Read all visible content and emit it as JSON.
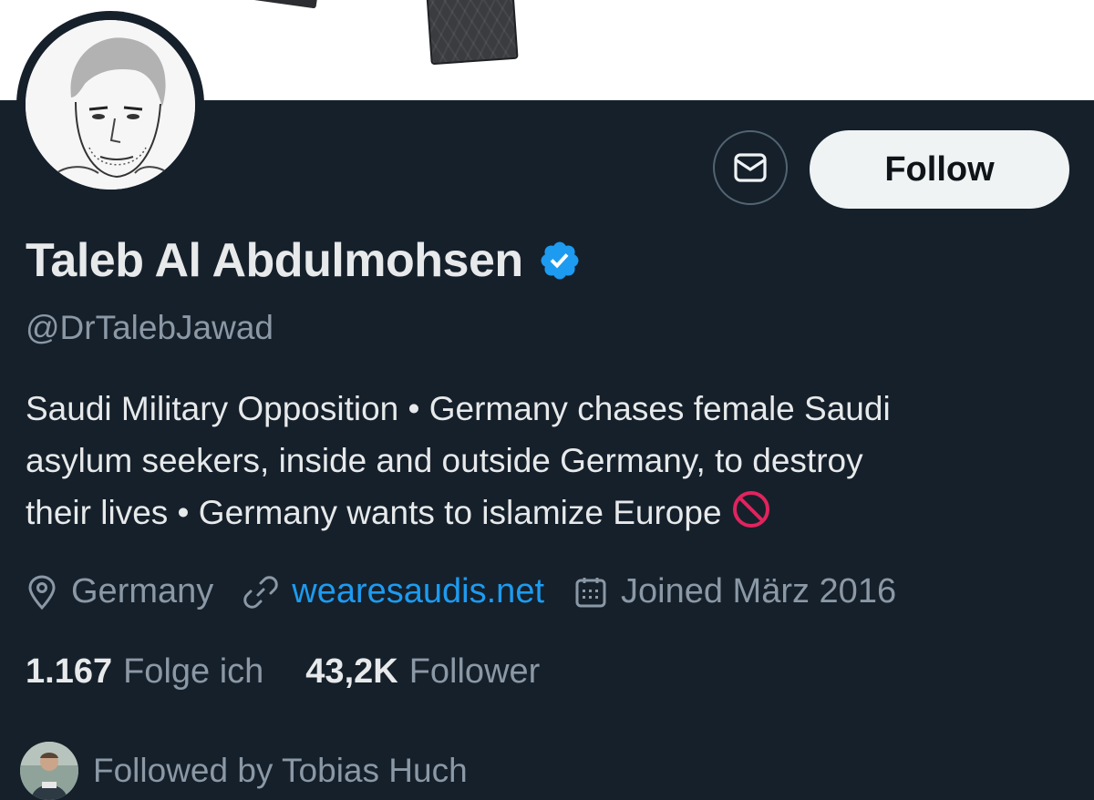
{
  "profile": {
    "name": "Taleb Al Abdulmohsen",
    "handle": "@DrTalebJawad",
    "verified": true,
    "bio_lines": [
      "Saudi Military Opposition • Germany chases female Saudi",
      "asylum seekers, inside and outside Germany, to destroy",
      "their lives • Germany wants to islamize Europe"
    ],
    "bio_trailing_icon": "no-entry-icon",
    "location": "Germany",
    "website": "wearesaudis.net",
    "joined": "Joined März 2016"
  },
  "actions": {
    "follow_label": "Follow",
    "message_icon": "envelope-icon"
  },
  "stats": {
    "following_count": "1.167",
    "following_label": "Folge ich",
    "followers_count": "43,2K",
    "followers_label": "Follower"
  },
  "social_proof": {
    "text": "Followed by Tobias Huch"
  },
  "colors": {
    "background": "#15202b",
    "primary_text": "#e7e9ea",
    "secondary_text": "#8b98a5",
    "link": "#1d9bf0",
    "verified_badge": "#1d9bf0",
    "follow_button_bg": "#eff3f4"
  }
}
